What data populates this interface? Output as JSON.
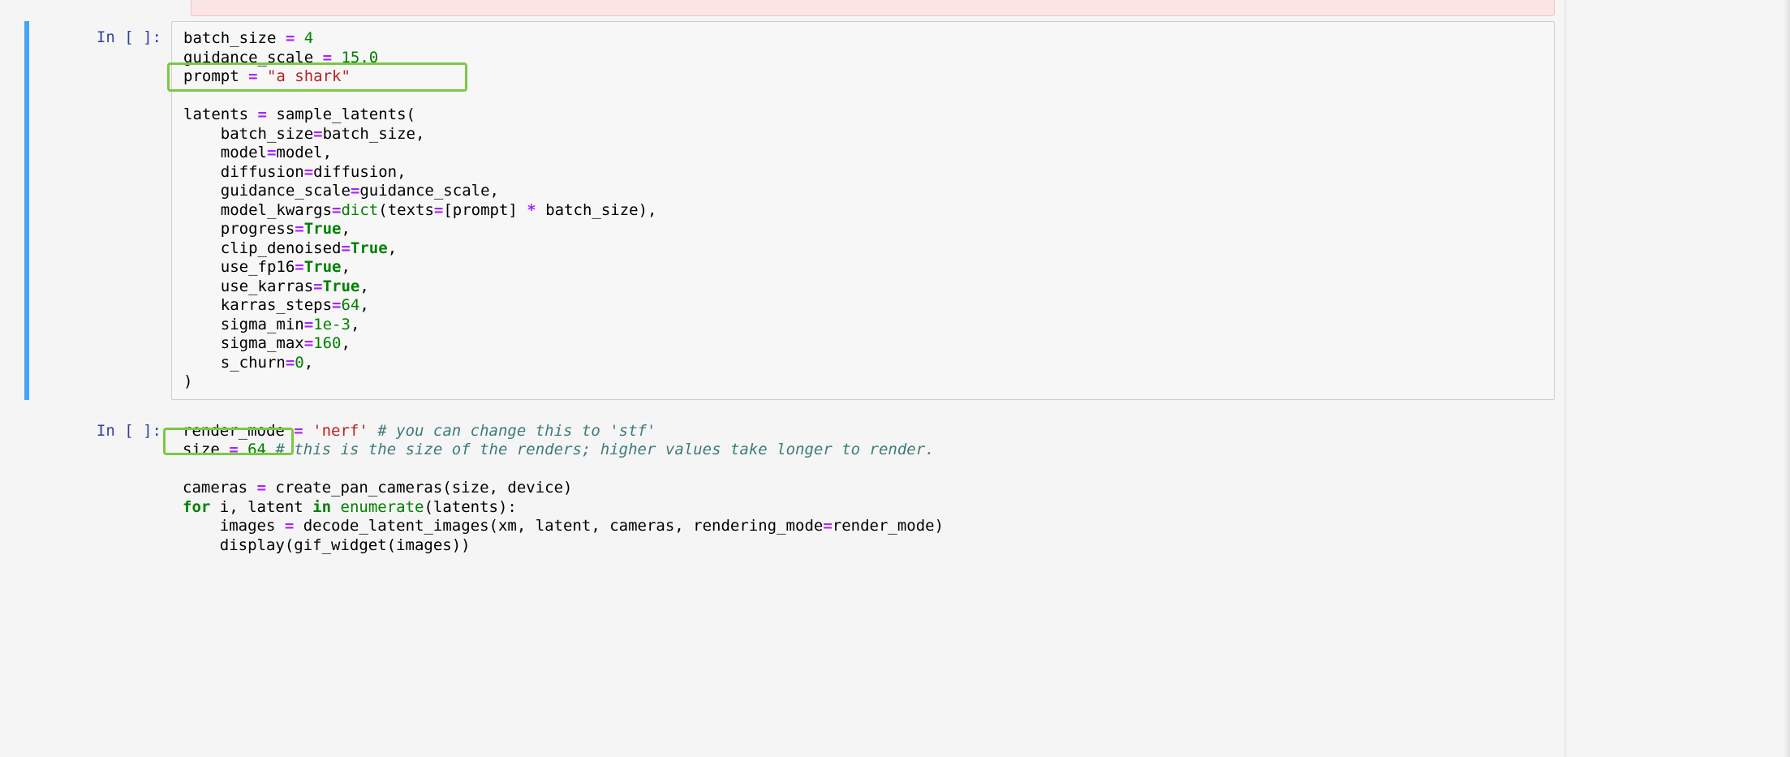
{
  "prompts": {
    "cell1": "In [ ]:",
    "cell2": "In [ ]:"
  },
  "cell1": {
    "line01_a": "batch_size ",
    "line01_op": "=",
    "line01_num": " 4",
    "line02_a": "guidance_scale ",
    "line02_op": "=",
    "line02_num": " 15.0",
    "line03_a": "prompt ",
    "line03_op": "=",
    "line03_str": " \"a shark\"",
    "blank1": "",
    "line05_a": "latents ",
    "line05_op": "=",
    "line05_b": " sample_latents(",
    "line06": "    batch_size",
    "line06_op": "=",
    "line06_b": "batch_size,",
    "line07": "    model",
    "line07_op": "=",
    "line07_b": "model,",
    "line08": "    diffusion",
    "line08_op": "=",
    "line08_b": "diffusion,",
    "line09": "    guidance_scale",
    "line09_op": "=",
    "line09_b": "guidance_scale,",
    "line10": "    model_kwargs",
    "line10_op": "=",
    "line10_builtin": "dict",
    "line10_b": "(texts",
    "line10_op2": "=",
    "line10_c": "[prompt] ",
    "line10_star": "*",
    "line10_d": " batch_size),",
    "line11": "    progress",
    "line11_op": "=",
    "line11_bool": "True",
    "line11_comma": ",",
    "line12": "    clip_denoised",
    "line12_op": "=",
    "line12_bool": "True",
    "line12_comma": ",",
    "line13": "    use_fp16",
    "line13_op": "=",
    "line13_bool": "True",
    "line13_comma": ",",
    "line14": "    use_karras",
    "line14_op": "=",
    "line14_bool": "True",
    "line14_comma": ",",
    "line15": "    karras_steps",
    "line15_op": "=",
    "line15_num": "64",
    "line15_comma": ",",
    "line16": "    sigma_min",
    "line16_op": "=",
    "line16_num": "1e-3",
    "line16_comma": ",",
    "line17": "    sigma_max",
    "line17_op": "=",
    "line17_num": "160",
    "line17_comma": ",",
    "line18": "    s_churn",
    "line18_op": "=",
    "line18_num": "0",
    "line18_comma": ",",
    "line19": ")"
  },
  "cell2": {
    "line01_a": "render_mode ",
    "line01_op": "=",
    "line01_str": " 'nerf'",
    "line01_sp": " ",
    "line01_comment": "# you can change this to 'stf'",
    "line02_a": "size ",
    "line02_op": "=",
    "line02_num": " 64",
    "line02_sp": " ",
    "line02_comment": "# this is the size of the renders; higher values take longer to render.",
    "blank1": "",
    "line04_a": "cameras ",
    "line04_op": "=",
    "line04_b": " create_pan_cameras(size, device)",
    "line05_for": "for",
    "line05_a": " i, latent ",
    "line05_in": "in",
    "line05_b": " ",
    "line05_builtin": "enumerate",
    "line05_c": "(latents):",
    "line06_a": "    images ",
    "line06_op": "=",
    "line06_b": " decode_latent_images(xm, latent, cameras, rendering_mode",
    "line06_op2": "=",
    "line06_c": "render_mode)",
    "line07_a": "    display(gif_widget(images))"
  }
}
